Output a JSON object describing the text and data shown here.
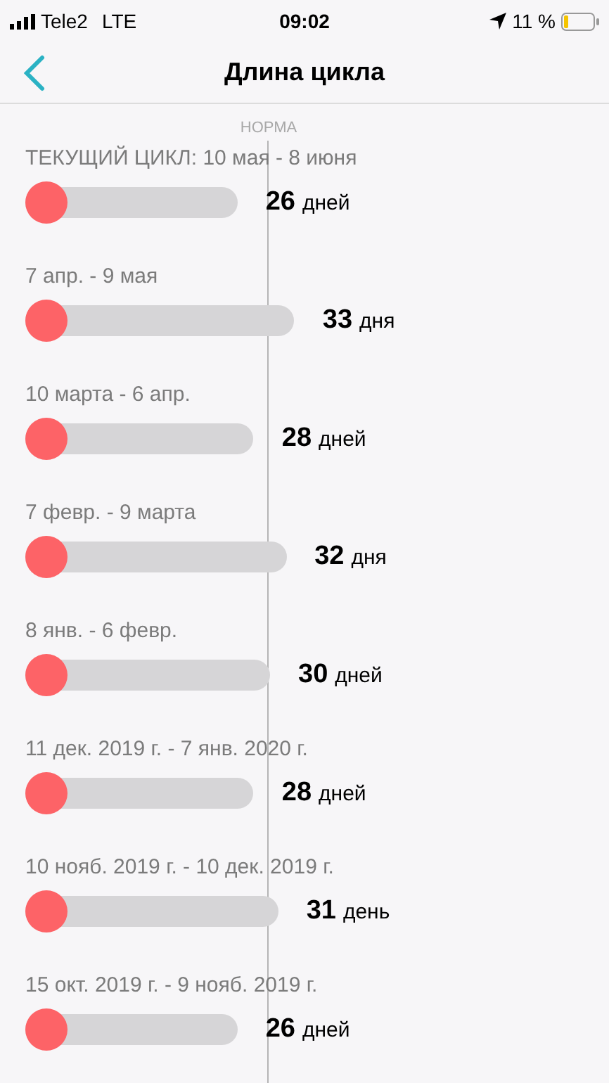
{
  "status_bar": {
    "carrier": "Tele2",
    "network": "LTE",
    "time": "09:02",
    "battery": "11 %"
  },
  "nav": {
    "title": "Длина цикла"
  },
  "norm_label": "НОРМА",
  "cycles": [
    {
      "label": "ТЕКУЩИЙ ЦИКЛ: 10 мая - 8 июня",
      "count": "26",
      "unit": "дней"
    },
    {
      "label": "7 апр. - 9 мая",
      "count": "33",
      "unit": "дня"
    },
    {
      "label": "10 марта - 6 апр.",
      "count": "28",
      "unit": "дней"
    },
    {
      "label": "7 февр. - 9 марта",
      "count": "32",
      "unit": "дня"
    },
    {
      "label": "8 янв. - 6 февр.",
      "count": "30",
      "unit": "дней"
    },
    {
      "label": "11 дек. 2019 г. - 7 янв. 2020 г.",
      "count": "28",
      "unit": "дней"
    },
    {
      "label": "10 нояб. 2019 г. - 10 дек. 2019 г.",
      "count": "31",
      "unit": "день"
    },
    {
      "label": "15 окт. 2019 г. - 9 нояб. 2019 г.",
      "count": "26",
      "unit": "дней"
    }
  ]
}
